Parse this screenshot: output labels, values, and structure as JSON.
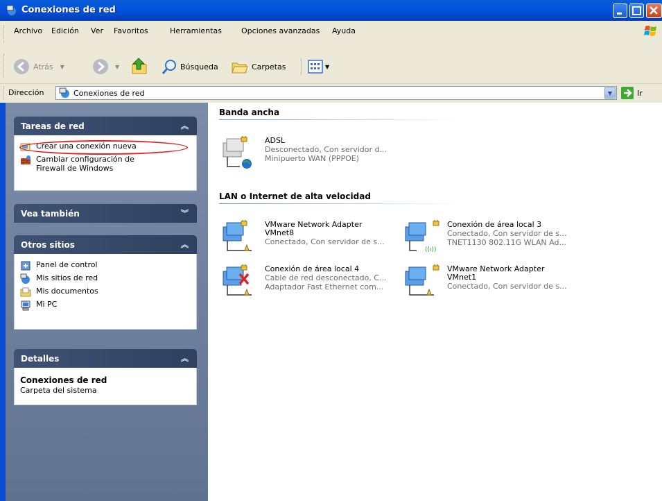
{
  "window": {
    "title": "Conexiones de red"
  },
  "menu": [
    "Archivo",
    "Edición",
    "Ver",
    "Favoritos",
    "Herramientas",
    "Opciones avanzadas",
    "Ayuda"
  ],
  "toolbar": {
    "back_label": "Atrás",
    "search_label": "Búsqueda",
    "folders_label": "Carpetas"
  },
  "address": {
    "label": "Dirección",
    "value": "Conexiones de red",
    "go_label": "Ir"
  },
  "sidebar": {
    "network_tasks": {
      "title": "Tareas de red",
      "items": [
        "Crear una conexión nueva",
        "Cambiar configuración de Firewall de Windows"
      ]
    },
    "see_also": {
      "title": "Vea también"
    },
    "other_places": {
      "title": "Otros sitios",
      "items": [
        "Panel de control",
        "Mis sitios de red",
        "Mis documentos",
        "Mi PC"
      ]
    },
    "details": {
      "title": "Detalles",
      "name": "Conexiones de red",
      "type": "Carpeta del sistema"
    }
  },
  "sections": {
    "broadband": {
      "title": "Banda ancha"
    },
    "lan": {
      "title": "LAN o Internet de alta velocidad"
    }
  },
  "connections": {
    "adsl": {
      "name": "ADSL",
      "status": "Desconectado, Con servidor d...",
      "device": "Minipuerto WAN (PPPOE)"
    },
    "vmnet8": {
      "name": "VMware Network Adapter",
      "name2": "VMnet8",
      "status": "Conectado, Con servidor de s..."
    },
    "local3": {
      "name": "Conexión de área local 3",
      "status": "Conectado, Con servidor de s...",
      "device": "TNET1130 802.11G WLAN Ad..."
    },
    "local4": {
      "name": "Conexión de área local 4",
      "status": "Cable de red desconectado, C...",
      "device": "Adaptador Fast Ethernet com..."
    },
    "vmnet1": {
      "name": "VMware Network Adapter",
      "name2": "VMnet1",
      "status": "Conectado, Con servidor de s..."
    }
  },
  "colors": {
    "title_bar": "#0454e0",
    "sidebar": "#6d7f9c",
    "panel_header": "#3f5273",
    "annotation": "#e02020"
  }
}
